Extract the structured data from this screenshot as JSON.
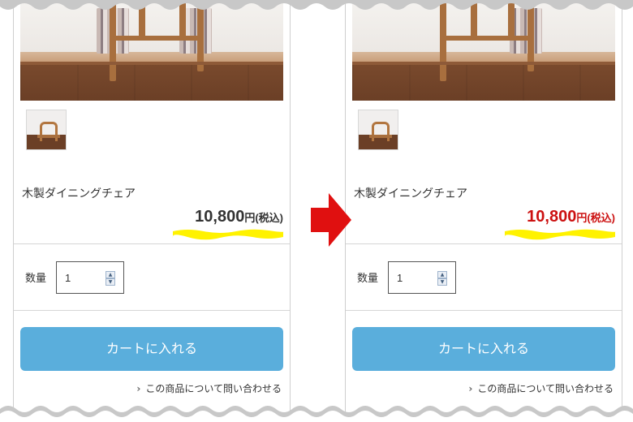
{
  "panels": [
    {
      "product_name": "木製ダイニングチェア",
      "price_number": "10,800",
      "price_unit": "円(税込)",
      "price_color": "#333333",
      "qty_label": "数量",
      "qty_value": "1",
      "cart_button": "カートに入れる",
      "inquiry_link": "この商品について問い合わせる"
    },
    {
      "product_name": "木製ダイニングチェア",
      "price_number": "10,800",
      "price_unit": "円(税込)",
      "price_color": "#cc1111",
      "qty_label": "数量",
      "qty_value": "1",
      "cart_button": "カートに入れる",
      "inquiry_link": "この商品について問い合わせる"
    }
  ],
  "colors": {
    "cart_button": "#5aaedc",
    "highlight": "#fff200",
    "arrow": "#e01010",
    "torn_edge": "#c8c8c8"
  },
  "icons": {
    "arrow": "arrow-right-icon",
    "chevron": "chevron-right-icon",
    "stepper_up": "triangle-up-icon",
    "stepper_down": "triangle-down-icon"
  }
}
